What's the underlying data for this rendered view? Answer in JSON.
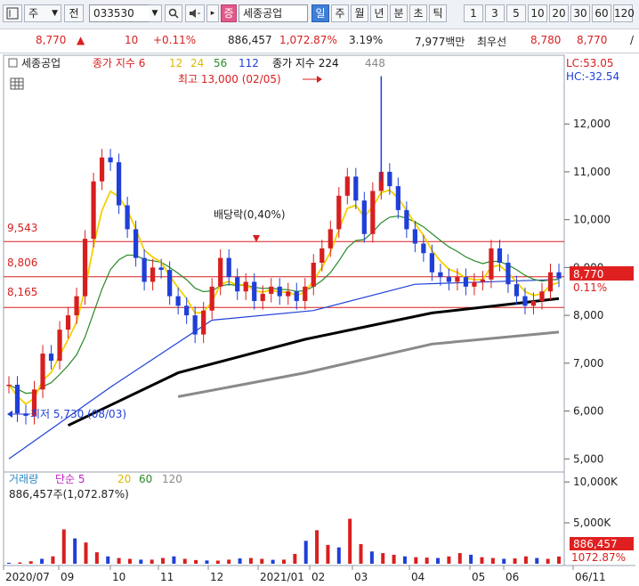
{
  "toolbar": {
    "icon_label": "chart-window-icon",
    "type_select": "주",
    "prev_label": "전",
    "code": "033530",
    "search_icon": "search-icon",
    "sound_icon": "speaker-icon",
    "badge": "증",
    "stock_name": "세종공업",
    "periods": [
      "일",
      "주",
      "월",
      "년",
      "분",
      "초",
      "틱"
    ],
    "active_period": "일",
    "counts": [
      "1",
      "3",
      "5",
      "10",
      "20",
      "30",
      "60",
      "120"
    ]
  },
  "quote": {
    "price": "8,770",
    "arrow": "▲",
    "change": "10",
    "change_pct": "+0.11%",
    "volume": "886,457",
    "volume_pct": "1,072.87%",
    "turnover": "3.19%",
    "amount": "7,977백만",
    "bid_label": "최우선",
    "bid": "8,780",
    "ask": "8,770",
    "cut": "/"
  },
  "legend": {
    "name": "세종공업",
    "ma_label": "종가 지수 6",
    "ma12": "12",
    "ma24": "24",
    "ma56": "56",
    "ma112": "112",
    "ma224_label": "종가 지수 224",
    "ma448": "448",
    "lc": "LC:53.05",
    "hc": "HC:-32.54"
  },
  "annotations": {
    "high": "최고 13,000 (02/05)",
    "low": "최저 5,730 (08/03)",
    "dividend": "배당락(0,40%)",
    "price_tag": "8,770",
    "pct_tag": "0.11%",
    "hline1": "9,543",
    "hline2": "8,806",
    "hline3": "8,165"
  },
  "volume_panel": {
    "legend_vol": "거래량",
    "legend_simple": "단순 5",
    "legend_20": "20",
    "legend_60": "60",
    "legend_120": "120",
    "info": "886,457주(1,072.87%)",
    "tag": "886,457",
    "tag_pct": "1072.87%"
  },
  "colors": {
    "up": "#d81f1f",
    "down": "#1f3fd8",
    "ma6": "#d81f1f",
    "ma12": "#f5d000",
    "ma24": "#f5d000",
    "ma56": "#2a8a2a",
    "ma112": "#1f3fd8",
    "ma224": "#000000",
    "ma448": "#8a8a8a",
    "hline": "#d81f1f"
  },
  "chart_data": {
    "type": "candlestick",
    "x_labels": [
      "2020/07",
      "09",
      "10",
      "11",
      "12",
      "2021/01",
      "02",
      "03",
      "04",
      "05",
      "06",
      "06/11"
    ],
    "price_ticks": [
      5000,
      6000,
      7000,
      8000,
      9000,
      10000,
      11000,
      12000
    ],
    "price_tick_labels": [
      "5,000",
      "6,000",
      "7,000",
      "8,000",
      "9,000",
      "10,000",
      "11,000",
      "12,000"
    ],
    "ylim": [
      4800,
      13400
    ],
    "reference_lines": [
      9543,
      8806,
      8165
    ],
    "close_series": [
      [
        0,
        6550
      ],
      [
        1,
        5950
      ],
      [
        2,
        5900
      ],
      [
        3,
        6450
      ],
      [
        4,
        7200
      ],
      [
        5,
        7050
      ],
      [
        6,
        7700
      ],
      [
        7,
        8000
      ],
      [
        8,
        8400
      ],
      [
        9,
        9600
      ],
      [
        10,
        10800
      ],
      [
        11,
        11300
      ],
      [
        12,
        11200
      ],
      [
        13,
        10300
      ],
      [
        14,
        9800
      ],
      [
        15,
        9200
      ],
      [
        16,
        8700
      ],
      [
        17,
        9000
      ],
      [
        18,
        8950
      ],
      [
        19,
        8400
      ],
      [
        20,
        8200
      ],
      [
        21,
        8000
      ],
      [
        22,
        7600
      ],
      [
        23,
        8100
      ],
      [
        24,
        8600
      ],
      [
        25,
        9200
      ],
      [
        26,
        8800
      ],
      [
        27,
        8500
      ],
      [
        28,
        8700
      ],
      [
        29,
        8300
      ],
      [
        30,
        8450
      ],
      [
        31,
        8600
      ],
      [
        32,
        8400
      ],
      [
        33,
        8500
      ],
      [
        34,
        8300
      ],
      [
        35,
        8600
      ],
      [
        36,
        9100
      ],
      [
        37,
        9400
      ],
      [
        38,
        9800
      ],
      [
        39,
        10500
      ],
      [
        40,
        10900
      ],
      [
        41,
        10400
      ],
      [
        42,
        9700
      ],
      [
        43,
        10600
      ],
      [
        44,
        11000
      ],
      [
        45,
        10700
      ],
      [
        46,
        10200
      ],
      [
        47,
        9800
      ],
      [
        48,
        9500
      ],
      [
        49,
        9300
      ],
      [
        50,
        8900
      ],
      [
        51,
        8800
      ],
      [
        52,
        8700
      ],
      [
        53,
        8800
      ],
      [
        54,
        8600
      ],
      [
        55,
        8700
      ],
      [
        56,
        8750
      ],
      [
        57,
        9400
      ],
      [
        58,
        9100
      ],
      [
        59,
        8650
      ],
      [
        60,
        8400
      ],
      [
        61,
        8200
      ],
      [
        62,
        8300
      ],
      [
        63,
        8500
      ],
      [
        64,
        8900
      ],
      [
        65,
        8770
      ]
    ],
    "ma_series": {
      "ma224": [
        [
          7,
          5700
        ],
        [
          20,
          6800
        ],
        [
          35,
          7500
        ],
        [
          50,
          8050
        ],
        [
          65,
          8350
        ]
      ],
      "ma448": [
        [
          20,
          6300
        ],
        [
          35,
          6800
        ],
        [
          50,
          7400
        ],
        [
          65,
          7650
        ]
      ],
      "ma112": [
        [
          0,
          5000
        ],
        [
          12,
          6500
        ],
        [
          24,
          7900
        ],
        [
          36,
          8100
        ],
        [
          48,
          8650
        ],
        [
          65,
          8750
        ]
      ]
    },
    "high": 13000,
    "low": 5730,
    "last": 8770,
    "volume_ticks": [
      "5,000K",
      "10,000K"
    ],
    "volume_values": [
      120,
      160,
      300,
      600,
      900,
      4200,
      3100,
      2600,
      1400,
      900,
      700,
      600,
      500,
      500,
      700,
      900,
      600,
      450,
      400,
      380,
      500,
      650,
      700,
      600,
      480,
      500,
      1200,
      2800,
      4100,
      2300,
      2000,
      5500,
      2400,
      1500,
      1300,
      1100,
      900,
      800,
      750,
      700,
      900,
      1300,
      1100,
      800,
      700,
      600,
      650,
      900,
      700,
      600,
      886
    ]
  }
}
